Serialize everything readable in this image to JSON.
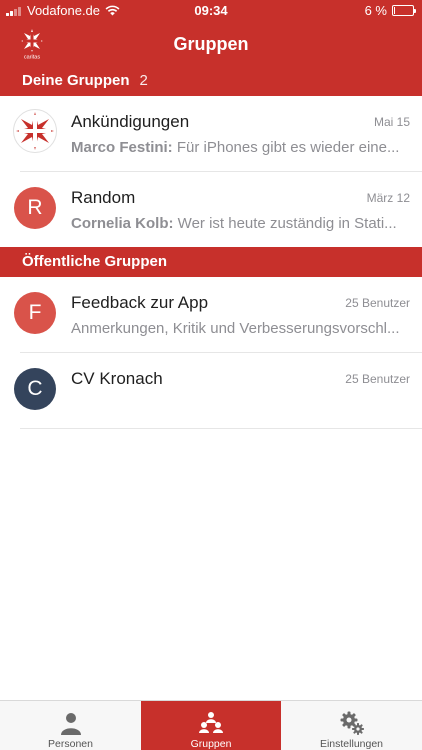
{
  "status_bar": {
    "carrier": "Vodafone.de",
    "time": "09:34",
    "battery": "6 %",
    "battery_level": 0.06
  },
  "nav": {
    "title": "Gruppen",
    "logo_text": "caritas"
  },
  "sections": {
    "mine": {
      "title": "Deine Gruppen",
      "count": "2"
    },
    "public": {
      "title": "Öffentliche Gruppen"
    }
  },
  "my_groups": [
    {
      "title": "Ankündigungen",
      "date": "Mai 15",
      "author": "Marco Festini:",
      "message": " Für iPhones gibt es wieder eine..."
    },
    {
      "initial": "R",
      "title": "Random",
      "date": "März 12",
      "author": "Cornelia Kolb:",
      "message": " Wer ist heute zuständig in Stati..."
    }
  ],
  "public_groups": [
    {
      "initial": "F",
      "title": "Feedback zur App",
      "members": "25 Benutzer",
      "description": "Anmerkungen, Kritik und Verbesserungsvorschl..."
    },
    {
      "initial": "C",
      "title": "CV Kronach",
      "members": "25 Benutzer",
      "description": ""
    }
  ],
  "tabs": [
    {
      "label": "Personen",
      "icon": "person-icon",
      "active": false
    },
    {
      "label": "Gruppen",
      "icon": "group-icon",
      "active": true
    },
    {
      "label": "Einstellungen",
      "icon": "gear-icon",
      "active": false
    }
  ],
  "colors": {
    "brand_red": "#c7302b",
    "avatar_red": "#d9534a",
    "avatar_navy": "#34445c"
  }
}
